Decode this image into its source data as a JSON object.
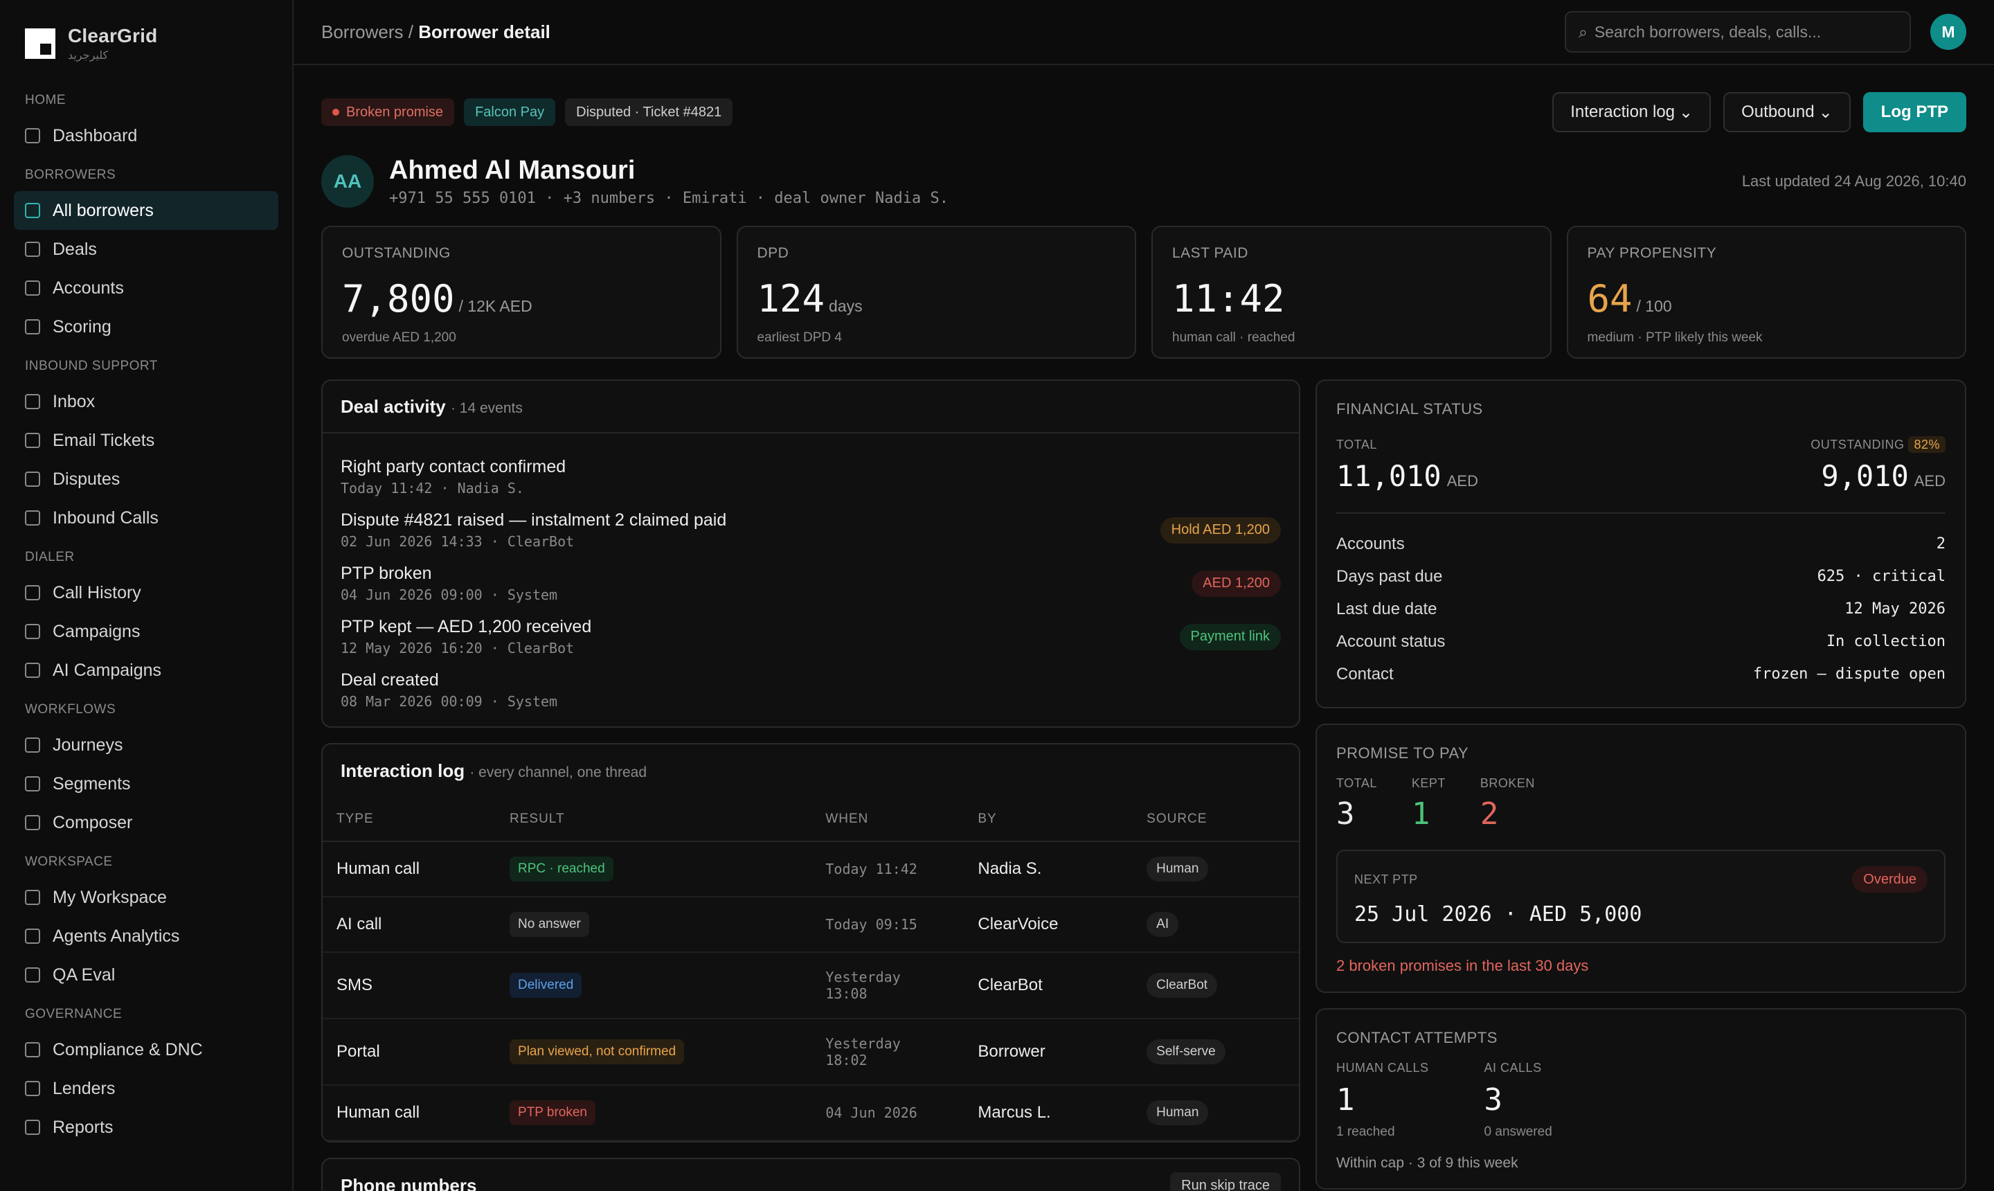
{
  "brand": {
    "name": "ClearGrid",
    "sub": "كليرجريد"
  },
  "sidebar": {
    "sections": [
      {
        "title": "HOME",
        "items": [
          "Dashboard"
        ]
      },
      {
        "title": "BORROWERS",
        "items": [
          "All borrowers",
          "Deals",
          "Accounts",
          "Scoring"
        ]
      },
      {
        "title": "INBOUND SUPPORT",
        "items": [
          "Inbox",
          "Email Tickets",
          "Disputes",
          "Inbound Calls"
        ]
      },
      {
        "title": "DIALER",
        "items": [
          "Call History",
          "Campaigns",
          "AI Campaigns"
        ]
      },
      {
        "title": "WORKFLOWS",
        "items": [
          "Journeys",
          "Segments",
          "Composer"
        ]
      },
      {
        "title": "WORKSPACE",
        "items": [
          "My Workspace",
          "Agents Analytics",
          "QA Eval"
        ]
      },
      {
        "title": "GOVERNANCE",
        "items": [
          "Compliance & DNC",
          "Lenders",
          "Reports"
        ]
      }
    ],
    "active": "All borrowers"
  },
  "topbar": {
    "crumb_parent": "Borrowers",
    "crumb_sep": "/",
    "crumb_current": "Borrower detail",
    "search_placeholder": "Search borrowers, deals, calls...",
    "search_icon": "⌕",
    "user_initial": "M"
  },
  "tags": {
    "broken": "Broken promise",
    "partner": "Falcon Pay",
    "disputed": "Disputed · Ticket #4821"
  },
  "actions": {
    "interaction_log": "Interaction log",
    "outbound": "Outbound",
    "log_ptp": "Log PTP",
    "caret": "⌄"
  },
  "borrower": {
    "initials": "AA",
    "name": "Ahmed Al Mansouri",
    "meta": "+971 55 555 0101 · +3 numbers · Emirati · deal owner Nadia S.",
    "updated": "Last updated 24 Aug 2026, 10:40"
  },
  "stats": [
    {
      "label": "OUTSTANDING",
      "value": "7,800",
      "unit": "/ 12K AED",
      "sub": "overdue AED 1,200"
    },
    {
      "label": "DPD",
      "value": "124",
      "unit": "days",
      "sub": "earliest DPD 4"
    },
    {
      "label": "LAST PAID",
      "value": "11:42",
      "unit": "",
      "sub": "human call · reached"
    },
    {
      "label": "PAY PROPENSITY",
      "value": "64",
      "unit": "/ 100",
      "sub": "medium · PTP likely this week"
    }
  ],
  "deal_activity": {
    "title": "Deal activity",
    "count": "· 14 events",
    "events": [
      {
        "title": "Right party contact confirmed",
        "meta": "Today 11:42 · Nadia S.",
        "pill": "",
        "pill_type": ""
      },
      {
        "title": "Dispute #4821 raised — instalment 2 claimed paid",
        "meta": "02 Jun 2026 14:33 · ClearBot",
        "pill": "Hold AED 1,200",
        "pill_type": "amber"
      },
      {
        "title": "PTP broken",
        "meta": "04 Jun 2026 09:00 · System",
        "pill": "AED 1,200",
        "pill_type": "red"
      },
      {
        "title": "PTP kept — AED 1,200 received",
        "meta": "12 May 2026 16:20 · ClearBot",
        "pill": "Payment link",
        "pill_type": "green"
      },
      {
        "title": "Deal created",
        "meta": "08 Mar 2026 00:09 · System",
        "pill": "",
        "pill_type": ""
      }
    ]
  },
  "interaction_log": {
    "title": "Interaction log",
    "sub": "· every channel, one thread",
    "columns": [
      "TYPE",
      "RESULT",
      "WHEN",
      "BY",
      "SOURCE"
    ],
    "rows": [
      {
        "type": "Human call",
        "result": "RPC · reached",
        "result_type": "green",
        "when": "Today 11:42",
        "by": "Nadia S.",
        "source": "Human"
      },
      {
        "type": "AI call",
        "result": "No answer",
        "result_type": "gray",
        "when": "Today 09:15",
        "by": "ClearVoice",
        "source": "AI"
      },
      {
        "type": "SMS",
        "result": "Delivered",
        "result_type": "blue",
        "when": "Yesterday 13:08",
        "by": "ClearBot",
        "source": "ClearBot"
      },
      {
        "type": "Portal",
        "result": "Plan viewed, not confirmed",
        "result_type": "amber",
        "when": "Yesterday 18:02",
        "by": "Borrower",
        "source": "Self-serve"
      },
      {
        "type": "Human call",
        "result": "PTP broken",
        "result_type": "red",
        "when": "04 Jun 2026",
        "by": "Marcus L.",
        "source": "Human"
      }
    ]
  },
  "phone_numbers": {
    "title": "Phone numbers",
    "action": "Run skip trace"
  },
  "financial": {
    "title": "FINANCIAL STATUS",
    "total_label": "TOTAL",
    "total": "11,010",
    "total_unit": "AED",
    "outstanding_label": "OUTSTANDING",
    "outstanding_pct": "82%",
    "outstanding": "9,010",
    "outstanding_unit": "AED",
    "rows": [
      {
        "k": "Accounts",
        "v": "2"
      },
      {
        "k": "Days past due",
        "v": "625 · critical"
      },
      {
        "k": "Last due date",
        "v": "12 May 2026"
      },
      {
        "k": "Account status",
        "v": "In collection"
      },
      {
        "k": "Contact",
        "v": "frozen — dispute open"
      }
    ]
  },
  "ptp": {
    "title": "PROMISE TO PAY",
    "total_label": "TOTAL",
    "total": "3",
    "kept_label": "KEPT",
    "kept": "1",
    "broken_label": "BROKEN",
    "broken": "2",
    "next_label": "NEXT PTP",
    "next_status": "Overdue",
    "next_value": "25 Jul 2026 · AED 5,000",
    "warning": "2 broken promises in the last 30 days"
  },
  "attempts": {
    "title": "CONTACT ATTEMPTS",
    "human_label": "HUMAN CALLS",
    "human": "1",
    "human_sub": "1 reached",
    "ai_label": "AI CALLS",
    "ai": "3",
    "ai_sub": "0 answered",
    "cap": "Within cap · 3 of 9 this week"
  },
  "colors": {
    "accent": "#0f8d8a",
    "red": "#e2665e",
    "amber": "#e5a64e",
    "green": "#4cc47c"
  }
}
